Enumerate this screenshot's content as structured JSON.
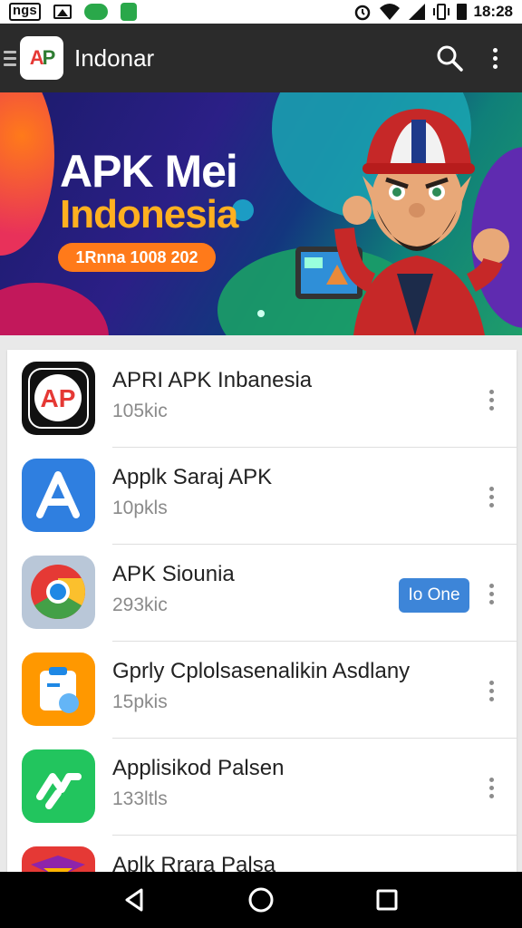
{
  "status_bar": {
    "left_tag": "ngs",
    "icons": [
      "gallery-icon",
      "gamepad-icon",
      "shield-icon"
    ],
    "right_icons": [
      "alarm-icon",
      "wifi-icon",
      "signal-icon",
      "vibrate-icon",
      "battery-icon"
    ],
    "time": "18:28"
  },
  "app_bar": {
    "title": "Indonar",
    "logo_text": [
      "A",
      "P"
    ],
    "actions": [
      "search-icon",
      "more-vert-icon"
    ]
  },
  "banner": {
    "title_line1": "APK Mei",
    "title_line2": "Indonesia",
    "pill_text": "1Rnna 1008 202"
  },
  "apps": [
    {
      "title": "APRI APK Inbanesia",
      "subtitle": "105kic",
      "icon": "ap-logo-icon",
      "action": ""
    },
    {
      "title": "Applk Saraj APK",
      "subtitle": "10pkls",
      "icon": "app-store-icon",
      "action": ""
    },
    {
      "title": "APK Siounia",
      "subtitle": "293kic",
      "icon": "chrome-icon",
      "action": "Io One"
    },
    {
      "title": "Gprly Cplolsasenalikin Asdlany",
      "subtitle": "15pkis",
      "icon": "clipboard-app-icon",
      "action": ""
    },
    {
      "title": "Applisikod Palsen",
      "subtitle": "133ltls",
      "icon": "arrow-app-icon",
      "action": ""
    },
    {
      "title": "Aplk Rrara Palsa",
      "subtitle": "",
      "icon": "red-app-icon",
      "action": ""
    }
  ],
  "nav_bar": {
    "buttons": [
      "back-icon",
      "home-icon",
      "recents-icon"
    ]
  },
  "colors": {
    "app_bar": "#2b2b2b",
    "accent_blue": "#3d85d8",
    "banner_orange": "#ff7a1a",
    "banner_yellow": "#ffb020"
  }
}
